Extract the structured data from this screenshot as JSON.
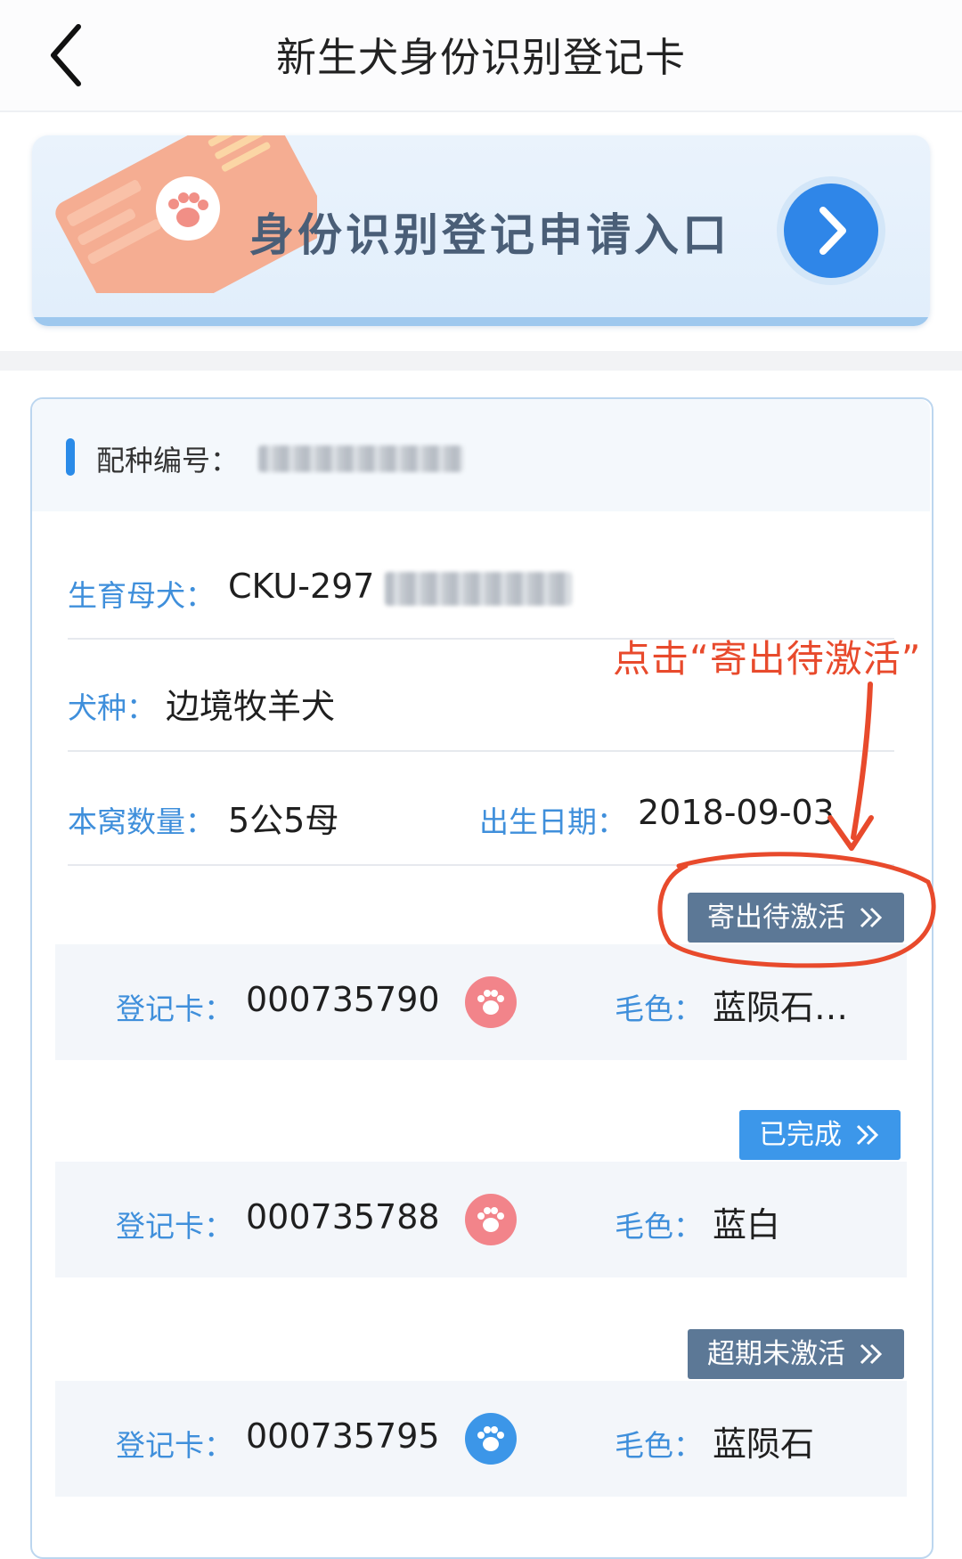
{
  "header": {
    "title": "新生犬身份识别登记卡"
  },
  "banner": {
    "text": "身份识别登记申请入口"
  },
  "record": {
    "breed_number_label": "配种编号：",
    "dam_label": "生育母犬：",
    "dam_value_prefix": "CKU-297",
    "breed_label": "犬种：",
    "breed_value": "边境牧羊犬",
    "litter_label": "本窝数量：",
    "litter_value": "5公5母",
    "birth_label": "出生日期：",
    "birth_value": "2018-09-03"
  },
  "cards": [
    {
      "status": "寄出待激活",
      "card_label": "登记卡：",
      "card_number": "000735790",
      "paw_color": "#f2848a",
      "color_label": "毛色：",
      "color_value": "蓝陨石…"
    },
    {
      "status": "已完成",
      "card_label": "登记卡：",
      "card_number": "000735788",
      "paw_color": "#f2848a",
      "color_label": "毛色：",
      "color_value": "蓝白"
    },
    {
      "status": "超期未激活",
      "card_label": "登记卡：",
      "card_number": "000735795",
      "paw_color": "#3c96e8",
      "color_label": "毛色：",
      "color_value": "蓝陨石"
    }
  ],
  "annotation": {
    "text": "点击“寄出待激活”",
    "color": "#e84a2c"
  },
  "colors": {
    "accent": "#2a8be8",
    "label": "#3f8fdb",
    "tag_gray": "#5c7896",
    "tag_blue": "#3c97ea"
  },
  "icons": [
    "back-arrow-icon",
    "paw-icon",
    "chevron-right-icon",
    "double-chevron-icon"
  ]
}
